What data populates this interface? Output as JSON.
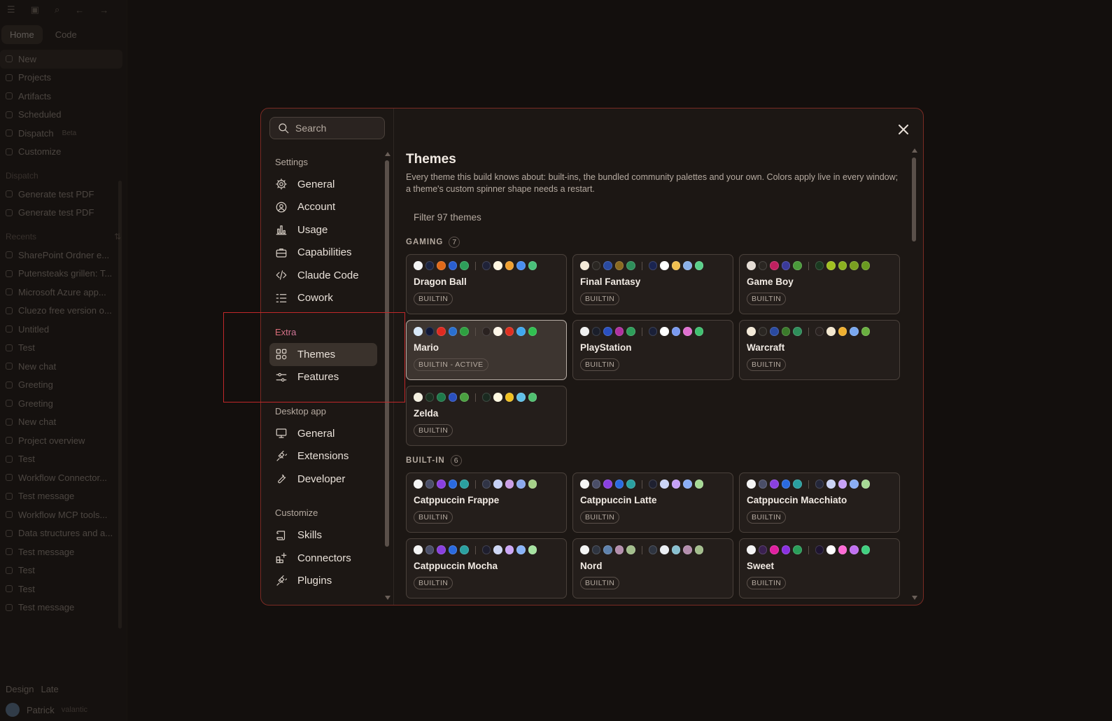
{
  "background_app": {
    "tabs": [
      "Home",
      "Code"
    ],
    "nav": [
      "New",
      "Projects",
      "Artifacts",
      "Scheduled",
      "Dispatch",
      "Customize"
    ],
    "dispatch_badge": "Beta",
    "dispatch_section": "Dispatch",
    "dispatch_items": [
      "Generate test PDF",
      "Generate test PDF"
    ],
    "recents_section": "Recents",
    "recents": [
      "SharePoint Ordner e...",
      "Putensteaks grillen: T...",
      "Microsoft Azure app...",
      "Cluezo free version o...",
      "Untitled",
      "Test",
      "New chat",
      "Greeting",
      "Greeting",
      "New chat",
      "Project overview",
      "Test",
      "Workflow Connector...",
      "Test message",
      "Workflow MCP tools...",
      "Data structures and a...",
      "Test message",
      "Test",
      "Test",
      "Test message"
    ],
    "bottom_row": [
      "Design",
      "Late"
    ],
    "user_name": "Patrick",
    "user_plan": "valantic"
  },
  "settings": {
    "search_placeholder": "Search",
    "sections": {
      "settings": "Settings",
      "extra": "Extra",
      "desktop": "Desktop app",
      "customize": "Customize"
    },
    "settings_items": [
      {
        "label": "General",
        "icon": "gear-icon"
      },
      {
        "label": "Account",
        "icon": "user-circle-icon"
      },
      {
        "label": "Usage",
        "icon": "bar-chart-icon"
      },
      {
        "label": "Capabilities",
        "icon": "briefcase-icon"
      },
      {
        "label": "Claude Code",
        "icon": "code-icon"
      },
      {
        "label": "Cowork",
        "icon": "checklist-icon"
      }
    ],
    "extra_items": [
      {
        "label": "Themes",
        "icon": "themes-icon"
      },
      {
        "label": "Features",
        "icon": "sliders-icon"
      }
    ],
    "desktop_items": [
      {
        "label": "General",
        "icon": "monitor-icon"
      },
      {
        "label": "Extensions",
        "icon": "plug-icon"
      },
      {
        "label": "Developer",
        "icon": "wrench-icon"
      }
    ],
    "customize_items": [
      {
        "label": "Skills",
        "icon": "scroll-icon"
      },
      {
        "label": "Connectors",
        "icon": "grid-plus-icon"
      },
      {
        "label": "Plugins",
        "icon": "plug-icon"
      }
    ]
  },
  "themes": {
    "title": "Themes",
    "description": "Every theme this build knows about: built-ins, the bundled community palettes and your own. Colors apply live in every window; a theme's custom spinner shape needs a restart.",
    "filter_placeholder": "Filter 97 themes",
    "groups": [
      {
        "name": "GAMING",
        "count": "7",
        "cards": [
          {
            "name": "Dragon Ball",
            "badge": "BUILTIN",
            "active": false,
            "colors_a": [
              "#f4f4f4",
              "#1a2340",
              "#e06a1a",
              "#2a5fd0",
              "#2e9e5a"
            ],
            "colors_b": [
              "#1f2238",
              "#fff6e0",
              "#f0a030",
              "#4a8ef0",
              "#4ac07a"
            ]
          },
          {
            "name": "Final Fantasy",
            "badge": "BUILTIN",
            "active": false,
            "colors_a": [
              "#f4ead8",
              "#2a2622",
              "#2a4aa0",
              "#8a6a20",
              "#2e8e5a"
            ],
            "colors_b": [
              "#1a2450",
              "#ffffff",
              "#f0c050",
              "#8ab0e8",
              "#5ad08a"
            ]
          },
          {
            "name": "Game Boy",
            "badge": "BUILTIN",
            "active": false,
            "colors_a": [
              "#e4dcd4",
              "#2a2622",
              "#c02060",
              "#3a3a9a",
              "#4a9a3a"
            ],
            "colors_b": [
              "#1a3a20",
              "#a0c020",
              "#8ab020",
              "#7aa020",
              "#6a9a20"
            ]
          },
          {
            "name": "Mario",
            "badge": "BUILTIN - ACTIVE",
            "active": true,
            "colors_a": [
              "#d8e8f8",
              "#101838",
              "#e02a20",
              "#2a70d0",
              "#2ea040"
            ],
            "colors_b": [
              "#2a2220",
              "#fff6e8",
              "#e03020",
              "#40a8f0",
              "#30c050"
            ]
          },
          {
            "name": "PlayStation",
            "badge": "BUILTIN",
            "active": false,
            "colors_a": [
              "#f0f0f0",
              "#1a1e2a",
              "#2a50c0",
              "#b030a0",
              "#2e9e5a"
            ],
            "colors_b": [
              "#1a2038",
              "#ffffff",
              "#7a9af0",
              "#e070d0",
              "#40c070"
            ]
          },
          {
            "name": "Warcraft",
            "badge": "BUILTIN",
            "active": false,
            "colors_a": [
              "#f4ead8",
              "#2a2622",
              "#2a4aa0",
              "#3a7a2a",
              "#2e8e5a"
            ],
            "colors_b": [
              "#2a2220",
              "#f4e8d0",
              "#f0b030",
              "#7aa8f0",
              "#6ab040"
            ]
          },
          {
            "name": "Zelda",
            "badge": "BUILTIN",
            "active": false,
            "colors_a": [
              "#f4f0e0",
              "#1a3020",
              "#1e7a4a",
              "#2a50c0",
              "#4aa040"
            ],
            "colors_b": [
              "#1a2a20",
              "#fff8e0",
              "#f0c020",
              "#60c0e8",
              "#50c070"
            ]
          }
        ]
      },
      {
        "name": "BUILT-IN",
        "count": "6",
        "cards": [
          {
            "name": "Catppuccin Frappe",
            "badge": "BUILTIN",
            "active": false,
            "colors_a": [
              "#f4f4f4",
              "#4a4e68",
              "#8a40e0",
              "#2a6ae0",
              "#2aa0a0"
            ],
            "colors_b": [
              "#303446",
              "#c6d0f5",
              "#ca9ee6",
              "#8caaee",
              "#a6d189"
            ]
          },
          {
            "name": "Catppuccin Latte",
            "badge": "BUILTIN",
            "active": false,
            "colors_a": [
              "#f4f4f4",
              "#4a4e68",
              "#8a40e0",
              "#2a6ae0",
              "#2aa0a0"
            ],
            "colors_b": [
              "#1e2030",
              "#cad3f5",
              "#c6a0f6",
              "#8aadf4",
              "#a6da95"
            ]
          },
          {
            "name": "Catppuccin Macchiato",
            "badge": "BUILTIN",
            "active": false,
            "colors_a": [
              "#f4f4f4",
              "#4a4e68",
              "#8a40e0",
              "#2a6ae0",
              "#2aa0a0"
            ],
            "colors_b": [
              "#24273a",
              "#cad3f5",
              "#c6a0f6",
              "#8aadf4",
              "#a6da95"
            ]
          },
          {
            "name": "Catppuccin Mocha",
            "badge": "BUILTIN",
            "active": false,
            "colors_a": [
              "#f4f4f4",
              "#4a4e68",
              "#8a40e0",
              "#2a6ae0",
              "#2aa0a0"
            ],
            "colors_b": [
              "#1e1e2e",
              "#cdd6f4",
              "#cba6f7",
              "#89b4fa",
              "#a6e3a1"
            ]
          },
          {
            "name": "Nord",
            "badge": "BUILTIN",
            "active": false,
            "colors_a": [
              "#f4f4f4",
              "#2e3440",
              "#5e81ac",
              "#b48ead",
              "#a3be8c"
            ],
            "colors_b": [
              "#2e3440",
              "#eceff4",
              "#88c0d0",
              "#b48ead",
              "#a3be8c"
            ]
          },
          {
            "name": "Sweet",
            "badge": "BUILTIN",
            "active": false,
            "colors_a": [
              "#f4f4f4",
              "#3a2050",
              "#e020a0",
              "#8a30e0",
              "#2a9e5a"
            ],
            "colors_b": [
              "#1e1430",
              "#ffffff",
              "#ff6ad5",
              "#c070f0",
              "#40d080"
            ]
          }
        ]
      }
    ]
  },
  "colors": {
    "accent_border": "#7a2b24",
    "highlight": "#c0282a"
  }
}
